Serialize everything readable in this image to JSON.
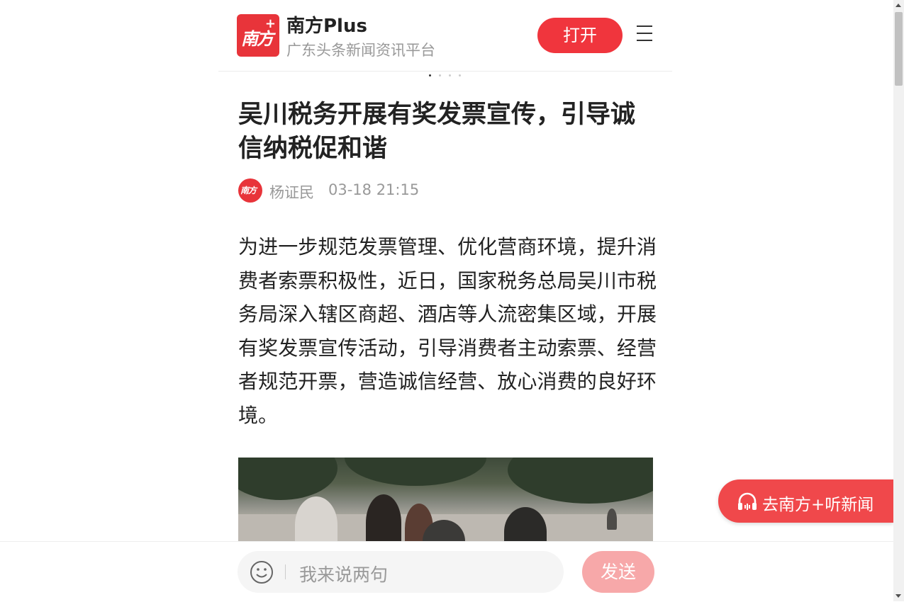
{
  "header": {
    "logo_text": "南方",
    "logo_plus": "+",
    "app_name": "南方Plus",
    "app_subtitle": "广东头条新闻资讯平台",
    "open_label": "打开",
    "menu_icon": "hamburger-menu-icon"
  },
  "article": {
    "title": "吴川税务开展有奖发票宣传，引导诚信纳税促和谐",
    "author": "杨证民",
    "time": "03-18 21:15",
    "paragraph": "为进一步规范发票管理、优化营商环境，提升消费者索票积极性，近日，国家税务总局吴川市税务局深入辖区商超、酒店等人流密集区域，开展有奖发票宣传活动，引导消费者主动索票、经营者规范开票，营造诚信经营、放心消费的良好环境。"
  },
  "listen": {
    "label": "去南方+听新闻",
    "icon": "headphones-icon"
  },
  "comment": {
    "placeholder": "我来说两句",
    "send_label": "发送",
    "emoji_icon": "smiley-icon"
  },
  "colors": {
    "brand_red": "#f0353d",
    "send_disabled": "#f7a8a9",
    "muted_text": "#999999"
  }
}
